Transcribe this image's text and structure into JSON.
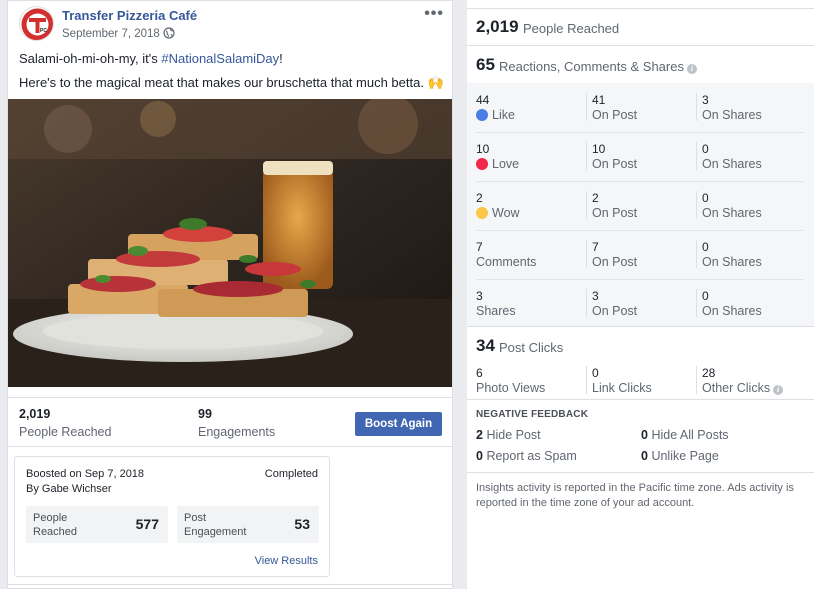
{
  "post": {
    "page_name": "Transfer Pizzeria Café",
    "date": "September 7, 2018",
    "more_label": "•••",
    "text_prefix": "Salami-oh-mi-oh-my, it's ",
    "hashtag": "#NationalSalamiDay",
    "text_suffix": "!",
    "text_line2": "Here's to the magical meat that makes our bruschetta that much betta. 🙌",
    "people_reached_value": "2,019",
    "people_reached_label": "People Reached",
    "engagements_value": "99",
    "engagements_label": "Engagements",
    "boost_again_label": "Boost Again"
  },
  "boost": {
    "boosted_on": "Boosted on Sep 7, 2018",
    "by": "By Gabe Wichser",
    "status": "Completed",
    "metrics": [
      {
        "label": "People Reached",
        "value": "577"
      },
      {
        "label": "Post Engagement",
        "value": "53"
      }
    ],
    "view_results_label": "View Results"
  },
  "insights": {
    "reach_value": "2,019",
    "reach_label": "People Reached",
    "rcs_value": "65",
    "rcs_label": "Reactions, Comments & Shares",
    "grid": [
      {
        "n1": "44",
        "l1": "Like",
        "icon": "like",
        "n2": "41",
        "l2": "On Post",
        "n3": "3",
        "l3": "On Shares"
      },
      {
        "n1": "10",
        "l1": "Love",
        "icon": "love",
        "n2": "10",
        "l2": "On Post",
        "n3": "0",
        "l3": "On Shares"
      },
      {
        "n1": "2",
        "l1": "Wow",
        "icon": "wow",
        "n2": "2",
        "l2": "On Post",
        "n3": "0",
        "l3": "On Shares"
      },
      {
        "n1": "7",
        "l1": "Comments",
        "icon": "",
        "n2": "7",
        "l2": "On Post",
        "n3": "0",
        "l3": "On Shares"
      },
      {
        "n1": "3",
        "l1": "Shares",
        "icon": "",
        "n2": "3",
        "l2": "On Post",
        "n3": "0",
        "l3": "On Shares"
      }
    ],
    "clicks_value": "34",
    "clicks_label": "Post Clicks",
    "clicks": [
      {
        "n": "6",
        "l": "Photo Views"
      },
      {
        "n": "0",
        "l": "Link Clicks"
      },
      {
        "n": "28",
        "l": "Other Clicks"
      }
    ],
    "negative_title": "NEGATIVE FEEDBACK",
    "negative": [
      {
        "n": "2",
        "l": "Hide Post"
      },
      {
        "n": "0",
        "l": "Hide All Posts"
      },
      {
        "n": "0",
        "l": "Report as Spam"
      },
      {
        "n": "0",
        "l": "Unlike Page"
      }
    ],
    "footnote": "Insights activity is reported in the Pacific time zone. Ads activity is reported in the time zone of your ad account."
  },
  "colors": {
    "link": "#365899",
    "button": "#4267b2",
    "like": "#4a7ee5",
    "love": "#f0284a",
    "wow": "#fcc746"
  },
  "icons": [
    "globe-icon",
    "more-options-icon",
    "like-reaction-icon",
    "love-reaction-icon",
    "wow-reaction-icon",
    "info-icon",
    "clap-emoji-icon"
  ]
}
